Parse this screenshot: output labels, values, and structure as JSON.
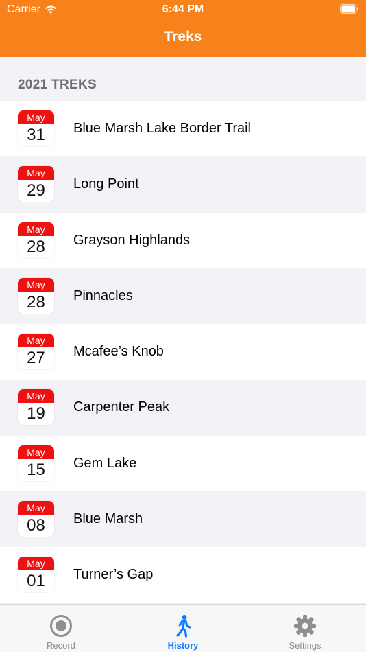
{
  "status_bar": {
    "carrier": "Carrier",
    "time": "6:44 PM"
  },
  "nav": {
    "title": "Treks"
  },
  "section": {
    "header": "2021 TREKS"
  },
  "treks": [
    {
      "month": "May",
      "day": "31",
      "name": "Blue Marsh Lake Border Trail"
    },
    {
      "month": "May",
      "day": "29",
      "name": "Long Point"
    },
    {
      "month": "May",
      "day": "28",
      "name": "Grayson Highlands"
    },
    {
      "month": "May",
      "day": "28",
      "name": "Pinnacles"
    },
    {
      "month": "May",
      "day": "27",
      "name": "Mcafee’s Knob"
    },
    {
      "month": "May",
      "day": "19",
      "name": "Carpenter Peak"
    },
    {
      "month": "May",
      "day": "15",
      "name": "Gem Lake"
    },
    {
      "month": "May",
      "day": "08",
      "name": "Blue Marsh"
    },
    {
      "month": "May",
      "day": "01",
      "name": "Turner’s Gap"
    }
  ],
  "tabs": [
    {
      "label": "Record",
      "icon": "record-icon",
      "active": false
    },
    {
      "label": "History",
      "icon": "walking-person-icon",
      "active": true
    },
    {
      "label": "Settings",
      "icon": "gear-icon",
      "active": false
    }
  ],
  "colors": {
    "header": "#f7821b",
    "calendar_red": "#ee1111",
    "tab_active": "#0a7bff",
    "tab_inactive": "#8e8e93"
  }
}
